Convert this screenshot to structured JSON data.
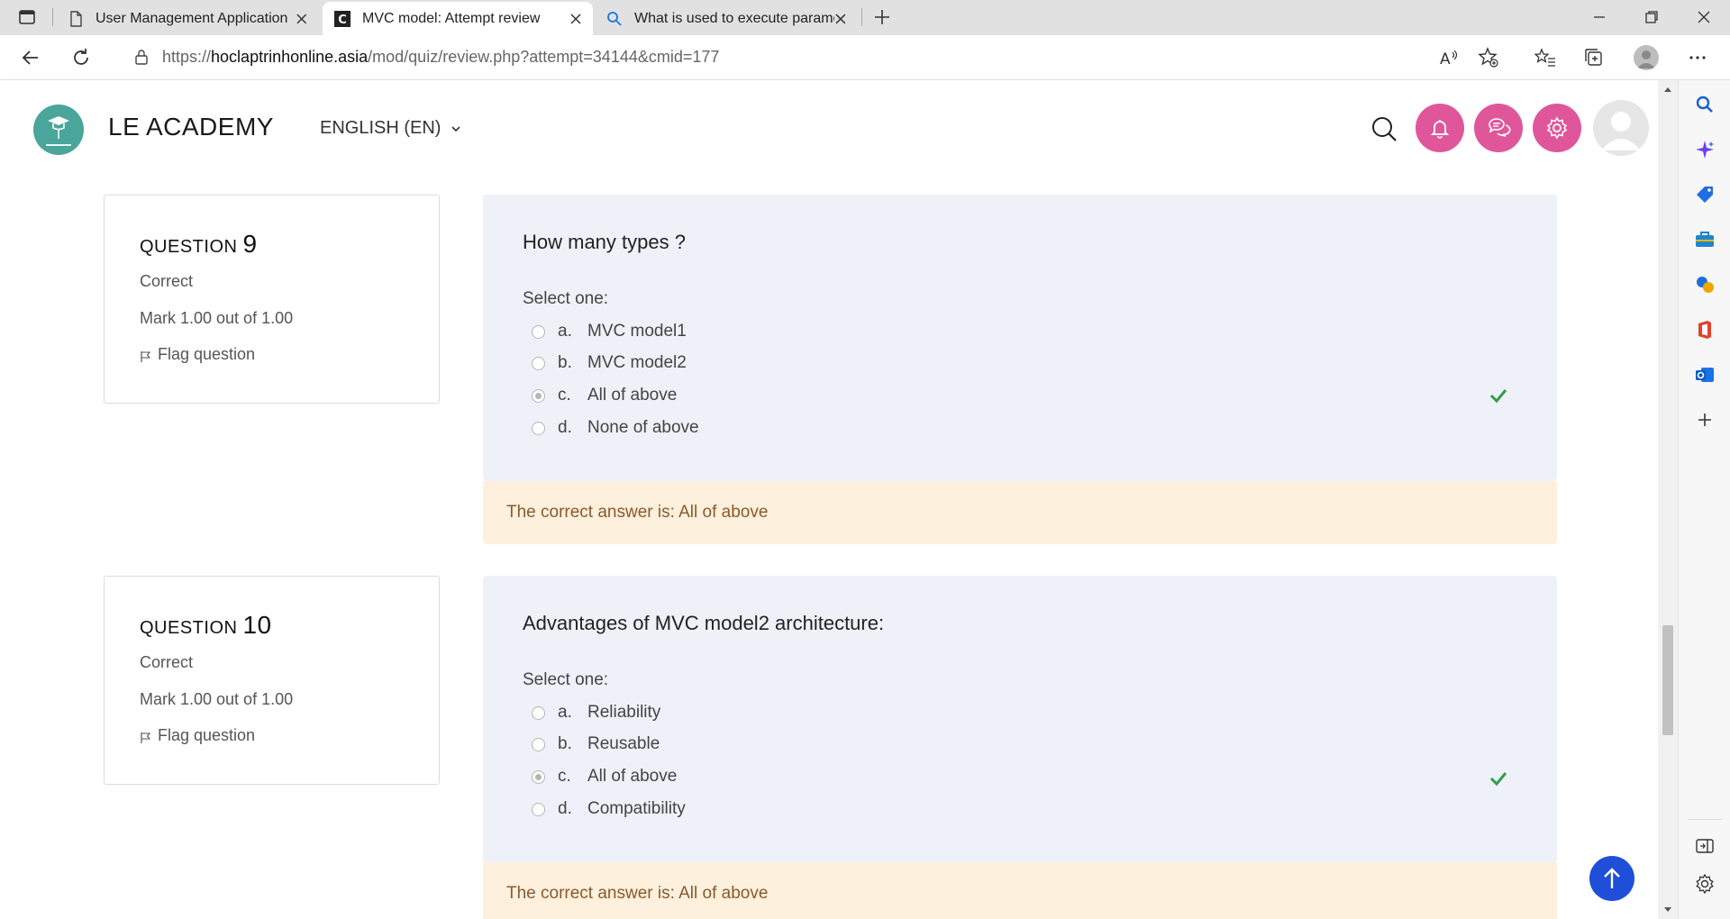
{
  "browser": {
    "tabs": [
      {
        "title": "User Management Application",
        "active": false
      },
      {
        "title": "MVC model: Attempt review",
        "active": true
      },
      {
        "title": "What is used to execute paramet",
        "active": false
      }
    ],
    "url": {
      "scheme": "https://",
      "host": "hoclaptrinhonline.asia",
      "path": "/mod/quiz/review.php?attempt=34144&cmid=177"
    }
  },
  "site": {
    "brand": "LE ACADEMY",
    "language": "ENGLISH (EN)"
  },
  "questions": [
    {
      "label": "QUESTION",
      "number": "9",
      "state": "Correct",
      "grade": "Mark 1.00 out of 1.00",
      "flag": "Flag question",
      "text": "How many types ?",
      "prompt": "Select one:",
      "answers": [
        {
          "letter": "a.",
          "text": "MVC model1"
        },
        {
          "letter": "b.",
          "text": "MVC model2"
        },
        {
          "letter": "c.",
          "text": "All of above"
        },
        {
          "letter": "d.",
          "text": "None of above"
        }
      ],
      "selected": 2,
      "feedback": "The correct answer is: All of above"
    },
    {
      "label": "QUESTION",
      "number": "10",
      "state": "Correct",
      "grade": "Mark 1.00 out of 1.00",
      "flag": "Flag question",
      "text": "Advantages of MVC model2 architecture:",
      "prompt": "Select one:",
      "answers": [
        {
          "letter": "a.",
          "text": "Reliability"
        },
        {
          "letter": "b.",
          "text": "Reusable"
        },
        {
          "letter": "c.",
          "text": "All of above"
        },
        {
          "letter": "d.",
          "text": "Compatibility"
        }
      ],
      "selected": 2,
      "feedback": "The correct answer is: All of above"
    }
  ],
  "colors": {
    "accent_pink": "#e0569b",
    "check_green": "#2e9e4f",
    "feedback_bg": "#fdf0dd",
    "question_bg": "#eef1f8",
    "back_to_top": "#1f4fd8"
  }
}
